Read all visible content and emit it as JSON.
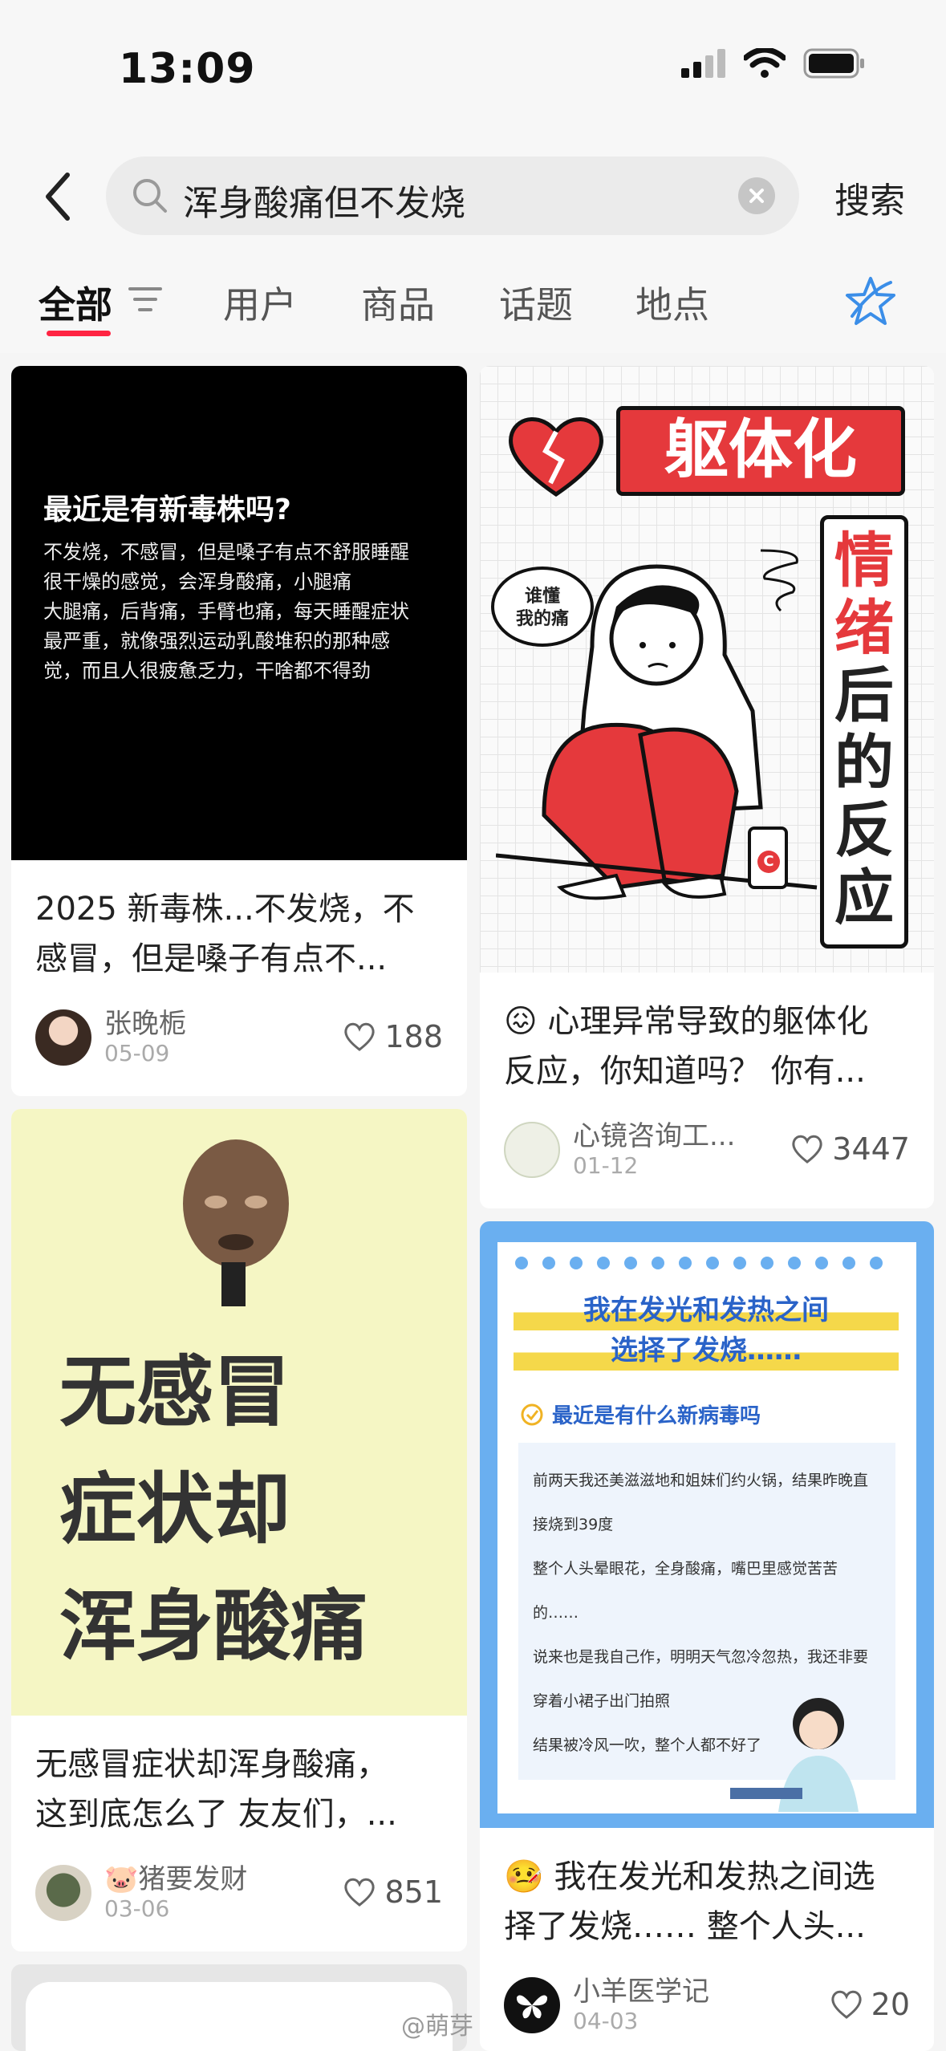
{
  "status_bar": {
    "time": "13:09"
  },
  "search": {
    "query": "浑身酸痛但不发烧",
    "button": "搜索"
  },
  "tabs": [
    "全部",
    "用户",
    "商品",
    "话题",
    "地点"
  ],
  "cards": [
    {
      "cover": {
        "heading": "最近是有新毒株吗?",
        "lines": [
          "不发烧，不感冒，但是嗓子有点不舒服睡醒",
          "很干燥的感觉，会浑身酸痛，小腿痛",
          "大腿痛，后背痛，手臂也痛，每天睡醒症状",
          "最严重，就像强烈运动乳酸堆积的那种感",
          "觉，而且人很疲惫乏力，干啥都不得劲"
        ]
      },
      "title_lines": [
        "2025 新毒株...不发烧，不",
        "感冒，但是嗓子有点不..."
      ],
      "author": "张晚栀",
      "date": "05-09",
      "likes": "188"
    },
    {
      "cover": {
        "banner": "躯体化",
        "vertical_red": [
          "情",
          "绪"
        ],
        "vertical_black": [
          "后",
          "的",
          "反",
          "应"
        ],
        "bubble": [
          "谁懂",
          "我的痛"
        ],
        "pill": "C"
      },
      "title_lines": [
        "😖 心理异常导致的躯体化",
        "反应，你知道吗？ 你有..."
      ],
      "author": "心镜咨询工...",
      "date": "01-12",
      "likes": "3447"
    },
    {
      "cover": {
        "lines": [
          "无感冒",
          "症状却",
          "浑身酸痛"
        ]
      },
      "title_lines": [
        "无感冒症状却浑身酸痛，",
        "这到底怎么了 友友们，..."
      ],
      "author": "🐷猪要发财",
      "date": "03-06",
      "likes": "851"
    },
    {
      "cover": {
        "title1": "我在发光和发热之间",
        "title2": "选择了发烧……",
        "sub": "最近是有什么新病毒吗",
        "lines": [
          "前两天我还美滋滋地和姐妹们约火锅，结果昨晚直",
          "接烧到39度",
          "整个人头晕眼花，全身酸痛，嘴巴里感觉苦苦",
          "的……",
          "说来也是我自己作，明明天气忽冷忽热，我还非要",
          "穿着小裙子出门拍照",
          "结果被冷风一吹，整个人都不好了"
        ]
      },
      "title_lines": [
        "🤒 我在发光和发热之间选",
        "择了发烧…… 整个人头..."
      ],
      "author": "小羊医学记",
      "date": "04-03",
      "likes": "20"
    }
  ],
  "watermark": "@萌芽",
  "colors": {
    "accent": "#ff2442",
    "star": "#3b8ee8"
  }
}
